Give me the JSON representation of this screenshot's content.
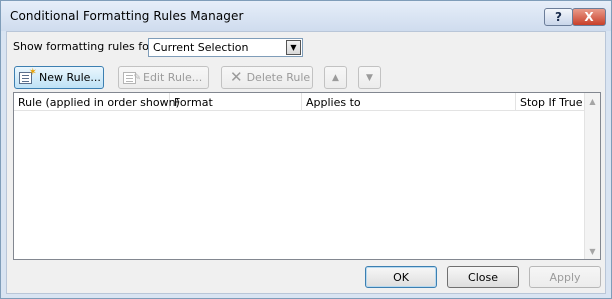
{
  "window": {
    "title": "Conditional Formatting Rules Manager",
    "help_label": "?",
    "close_label": "X"
  },
  "show_rules": {
    "label": "Show formatting rules for:",
    "selected": "Current Selection"
  },
  "toolbar": {
    "new_rule": "New Rule...",
    "edit_rule": "Edit Rule...",
    "delete_rule": "Delete Rule"
  },
  "table": {
    "columns": [
      "Rule (applied in order shown)",
      "Format",
      "Applies to",
      "Stop If True"
    ],
    "rows": []
  },
  "footer": {
    "ok": "OK",
    "close": "Close",
    "apply": "Apply"
  },
  "icons": {
    "new_rule": "new-rule-icon",
    "edit_rule": "edit-rule-icon",
    "delete_rule": "delete-icon",
    "move_up": "arrow-up-icon",
    "move_down": "arrow-down-icon",
    "dropdown": "chevron-down-icon"
  }
}
